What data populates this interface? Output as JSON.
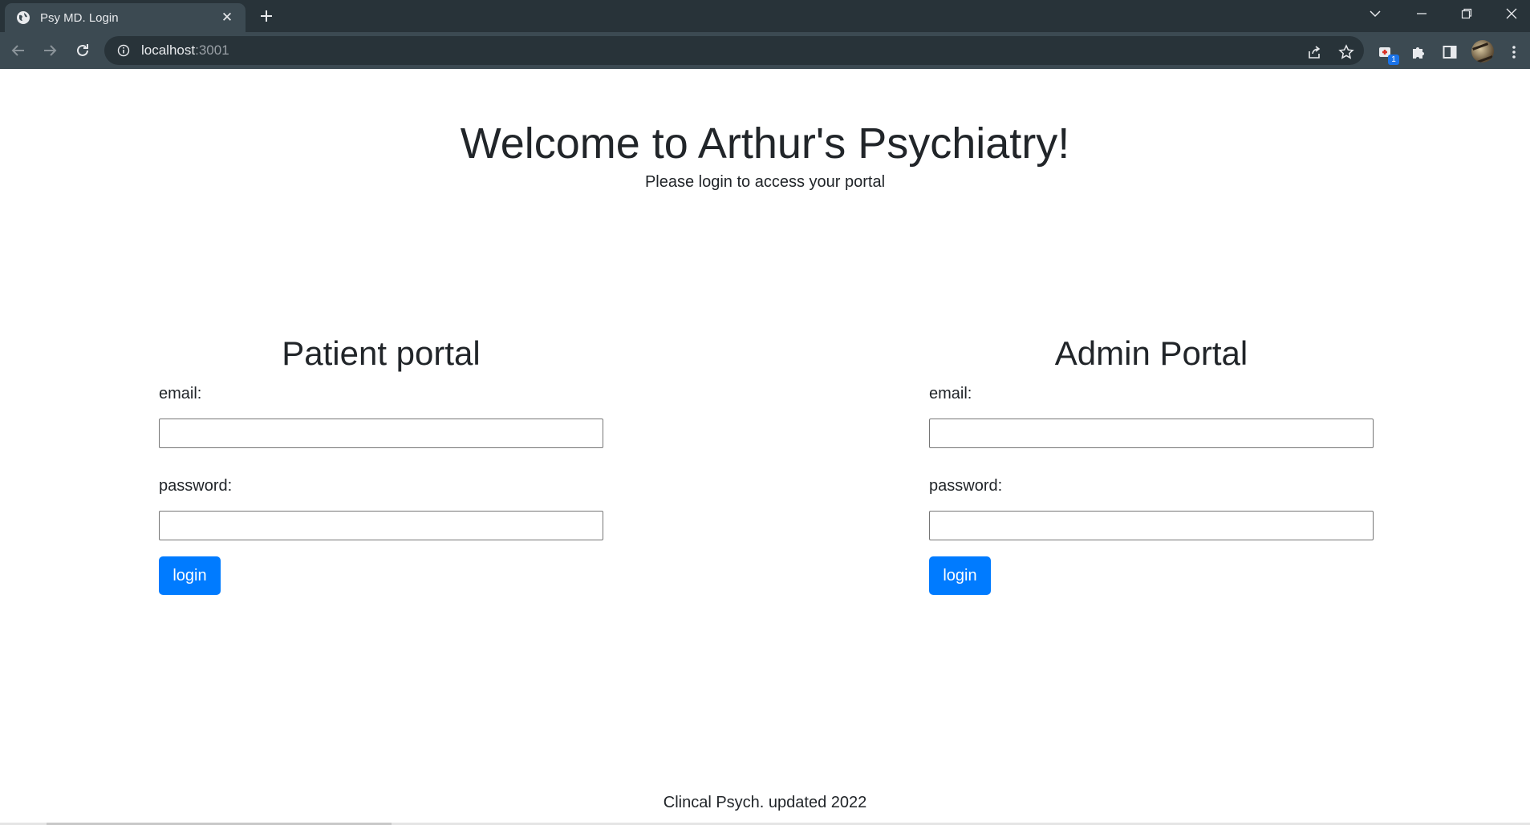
{
  "browser": {
    "tab_title": "Psy MD. Login",
    "url_host": "localhost",
    "url_port": ":3001",
    "extension_badge": "1"
  },
  "page": {
    "title": "Welcome to Arthur's Psychiatry!",
    "subtitle": "Please login to access your portal",
    "patient_portal": {
      "heading": "Patient portal",
      "email_label": "email:",
      "email_value": "",
      "password_label": "password:",
      "password_value": "",
      "login_label": "login"
    },
    "admin_portal": {
      "heading": "Admin Portal",
      "email_label": "email:",
      "email_value": "",
      "password_label": "password:",
      "password_value": "",
      "login_label": "login"
    },
    "footer": "Clincal Psych. updated 2022"
  },
  "colors": {
    "primary_button": "#007bff",
    "chrome_dark": "#283339",
    "chrome_tab": "#3c4a52",
    "text": "#212529"
  },
  "icons": {
    "tab_favicon": "globe-icon",
    "tab_close": "close-icon",
    "new_tab": "plus-icon",
    "back": "arrow-left-icon",
    "forward": "arrow-right-icon",
    "reload": "reload-icon",
    "site_info": "info-icon",
    "share": "share-icon",
    "bookmark": "star-icon",
    "extensions": "puzzle-icon",
    "side_panel": "side-panel-icon",
    "menu": "kebab-menu-icon"
  }
}
